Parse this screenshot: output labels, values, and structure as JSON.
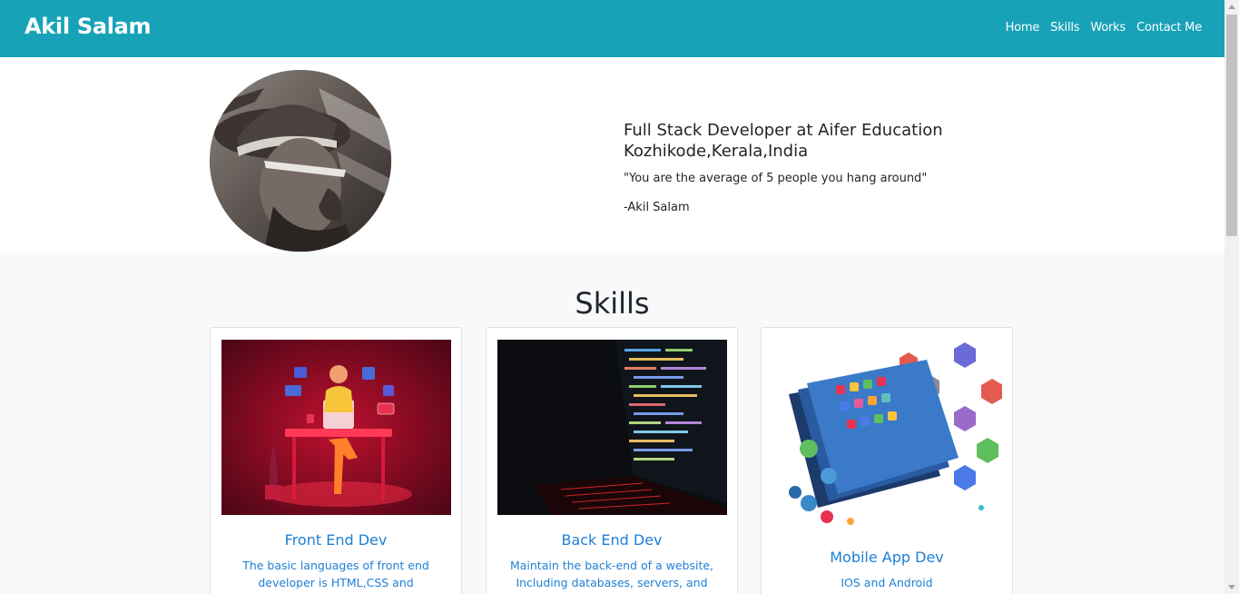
{
  "navbar": {
    "brand": "Akil Salam",
    "links": [
      {
        "label": "Home"
      },
      {
        "label": "Skills"
      },
      {
        "label": "Works"
      },
      {
        "label": "Contact Me"
      }
    ],
    "background": "#17a2b8"
  },
  "hero": {
    "title_line1": "Full Stack Developer at Aifer Education",
    "title_line2": "Kozhikode,Kerala,India",
    "quote": "\"You are the average of 5 people you hang around\"",
    "author": "-Akil Salam"
  },
  "skills": {
    "heading": "Skills",
    "cards": [
      {
        "title": "Front End Dev",
        "text_line1": "The basic languages of front end",
        "text_line2": "developer is HTML,CSS and Javascript",
        "image_icon": "front-end-developer-illustration"
      },
      {
        "title": "Back End Dev",
        "text_line1": "Maintain the back-end of a website,",
        "text_line2": "Including databases, servers, and apps.",
        "image_icon": "laptop-code-photo"
      },
      {
        "title": "Mobile App Dev",
        "text_line1": "IOS and Android",
        "image_icon": "mobile-apps-illustration"
      }
    ],
    "link_color": "#1e7fd6"
  }
}
